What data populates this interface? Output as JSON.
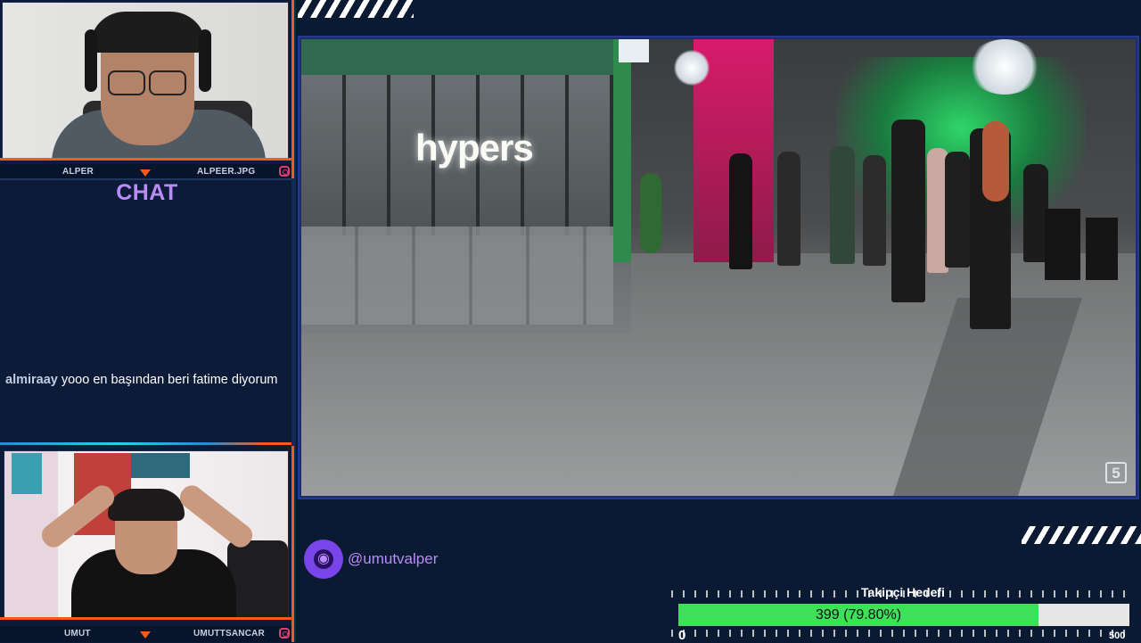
{
  "streamer_top": {
    "name": "ALPER",
    "social": "ALPEER.JPG"
  },
  "chat": {
    "title": "CHAT",
    "messages": [
      {
        "user": "almiraay",
        "text": "yooo en başından beri fatime diyorum"
      }
    ]
  },
  "streamer_bottom": {
    "name": "UMUT",
    "social": "UMUTTSANCAR"
  },
  "video": {
    "wall_sign": "hypers",
    "channel_logo": "5"
  },
  "handle": {
    "icon": "globe-icon",
    "text": "@umutvalper"
  },
  "follower_goal": {
    "title": "Takipçi Hedefi",
    "label": "399 (79.80%)",
    "current": 399,
    "target": 500,
    "fraction": 0.798,
    "min_label": "0",
    "max_label": "500"
  },
  "colors": {
    "accent_orange": "#f25a1e",
    "accent_purple": "#b98cf7",
    "goal_green": "#3ee05a",
    "background": "#0b1a33"
  }
}
